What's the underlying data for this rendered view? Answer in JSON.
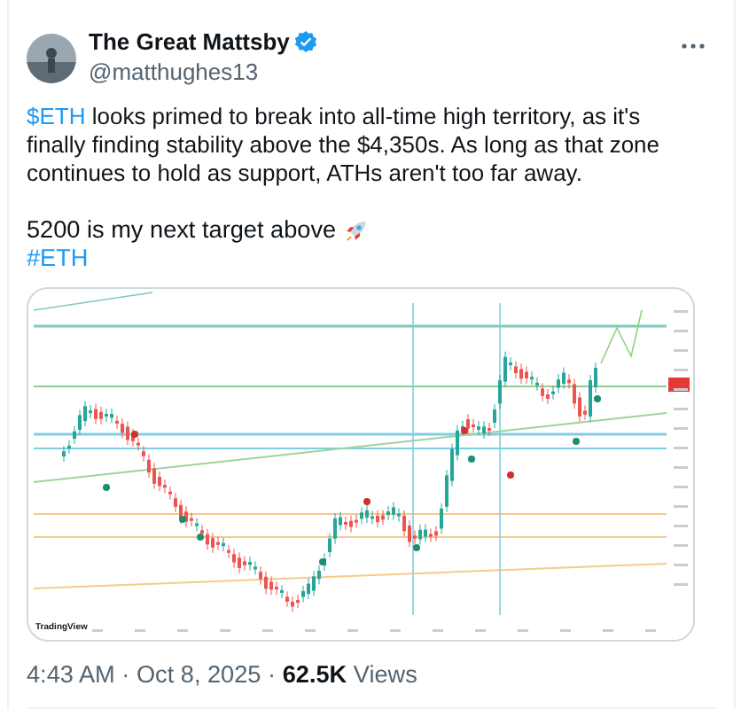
{
  "author": {
    "name": "The Great Mattsby",
    "verified": true,
    "handle": "@matthughes13"
  },
  "body": [
    {
      "kind": "cashtag",
      "text": "$ETH"
    },
    {
      "kind": "plain",
      "text": " looks primed to break into all-time high territory, as it's finally finding stability above the $4,350s. As long as that zone continues to hold as support, ATHs aren't too far away."
    }
  ],
  "target_line": "5200 is my next target above",
  "hashtag": "#ETH",
  "chart_image": {
    "brand": "TradingView"
  },
  "meta": "4:43 AM · Oct 8, 2025 · **62.5K** Views"
}
